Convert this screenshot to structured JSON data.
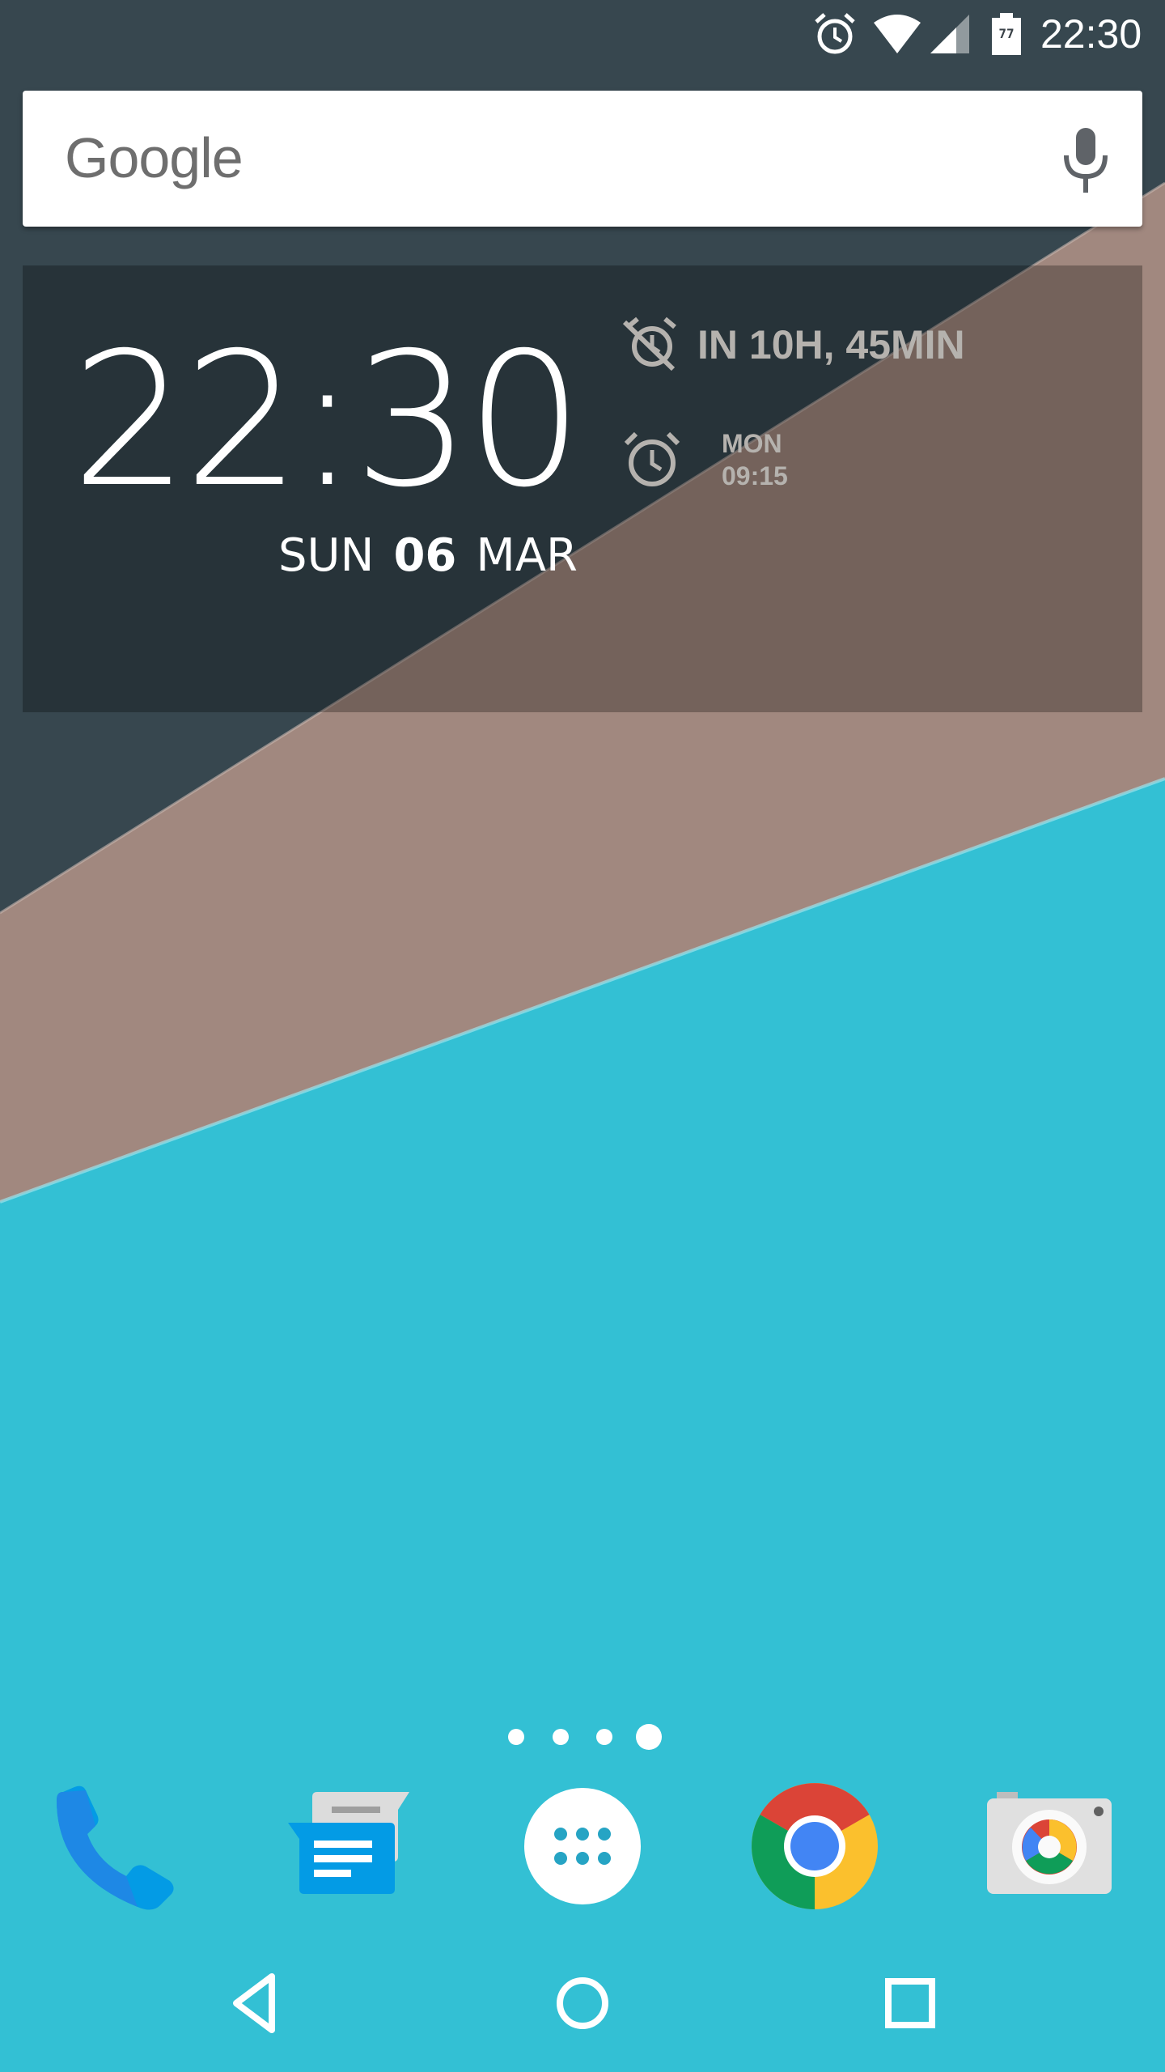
{
  "status_bar": {
    "time": "22:30",
    "battery_level": "77",
    "icons": [
      "alarm-icon",
      "wifi-icon",
      "signal-icon",
      "battery-icon"
    ]
  },
  "search": {
    "logo_text": "Google",
    "mic_icon": "mic-icon"
  },
  "clock_widget": {
    "time": "22:30",
    "day": "SUN",
    "date": "06",
    "month": "MAR",
    "alarm_countdown": "IN 10H, 45MIN",
    "next_alarm_day": "MON",
    "next_alarm_time": "09:15"
  },
  "page_indicator": {
    "count": 4,
    "active_index": 3
  },
  "dock": {
    "apps": [
      {
        "name": "phone-app",
        "icon": "phone-icon"
      },
      {
        "name": "messenger-app",
        "icon": "messages-icon"
      },
      {
        "name": "app-drawer",
        "icon": "apps-grid-icon"
      },
      {
        "name": "chrome-app",
        "icon": "chrome-icon"
      },
      {
        "name": "camera-app",
        "icon": "camera-icon"
      }
    ]
  },
  "nav_bar": {
    "icons": [
      "back-icon",
      "home-icon",
      "recents-icon"
    ]
  },
  "colors": {
    "wallpaper_dark": "#37474f",
    "wallpaper_brown": "#a1887f",
    "wallpaper_cyan": "#33c0d4",
    "alarm_text": "#b5b2ae"
  }
}
